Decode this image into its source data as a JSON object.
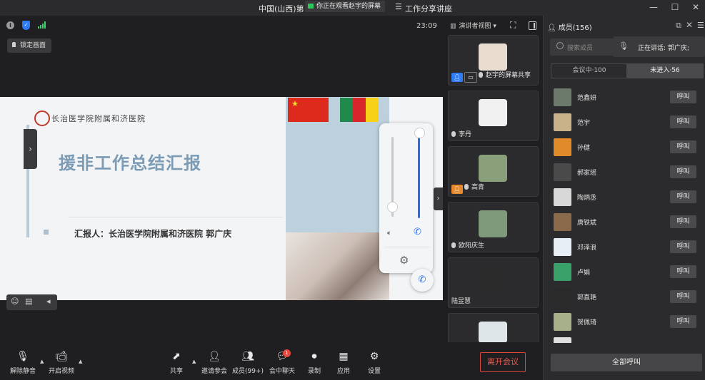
{
  "window": {
    "title": "中国(山西)第",
    "share_notice": "你正在观看赵宇的屏幕",
    "title_suffix": "工作分享讲座",
    "minimize": "—",
    "maximize": "☐",
    "close": "✕"
  },
  "toolbar": {
    "time": "23:09",
    "view_mode": "演讲者视图 ▾",
    "lock_screen": "锁定画面"
  },
  "slide": {
    "logo_text": "长治医学院附属和济医院",
    "title": "援非工作总结汇报",
    "presenter": "汇报人：长治医学院附属和济医院  郭广庆"
  },
  "video_tiles": [
    {
      "name": "赵宇的屏幕共享",
      "avatar_color": "#e9ddd0"
    },
    {
      "name": "李丹",
      "avatar_color": "#f0f0f0"
    },
    {
      "name": "高青",
      "avatar_color": "#8aa07a"
    },
    {
      "name": "欧阳庆生",
      "avatar_color": "#7e9a7a"
    },
    {
      "name": "陆昱慧",
      "avatar_color": "#2a2a2a"
    },
    {
      "name": "",
      "avatar_color": "#dfe6ea"
    }
  ],
  "members_panel": {
    "title": "成员(156)",
    "search_placeholder": "搜索成员",
    "speaking": "正在讲话: 郭广庆;",
    "tab_in_meeting": "会议中·100",
    "tab_not_joined": "未进入·56",
    "call_label": "呼叫",
    "call_all": "全部呼叫",
    "members": [
      {
        "name": "范鑫妍",
        "color": "#6b7a6a"
      },
      {
        "name": "范宇",
        "color": "#c9b28a"
      },
      {
        "name": "孙健",
        "color": "#e08a2a"
      },
      {
        "name": "郝家瑶",
        "color": "#4a4a4a"
      },
      {
        "name": "陶炳丞",
        "color": "#d8d8d8"
      },
      {
        "name": "唐铁斌",
        "color": "#8a6a4a"
      },
      {
        "name": "邓泽浪",
        "color": "#e8eef5"
      },
      {
        "name": "卢娟",
        "color": "#3aa06a"
      },
      {
        "name": "郭直艳",
        "color": "#2a2a2a"
      },
      {
        "name": "贺佩琦",
        "color": "#a8b08a"
      }
    ]
  },
  "bottom_bar": {
    "unmute": "解除静音",
    "start_video": "开启视频",
    "share": "共享",
    "invite": "邀请参会",
    "members": "成员(99+)",
    "chat": "会中聊天",
    "chat_badge": "1",
    "record": "录制",
    "apps": "应用",
    "settings": "设置",
    "leave": "离开会议"
  },
  "colors": {
    "accent_blue": "#2b6de8",
    "leave_red": "#e95a50",
    "signal_green": "#3bd16f"
  }
}
